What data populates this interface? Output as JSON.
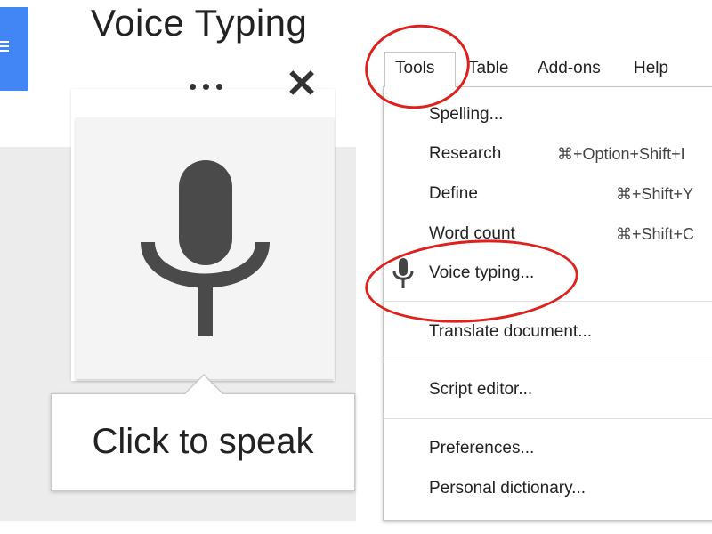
{
  "title": "Voice Typing",
  "voice_panel": {
    "more_icon": "more-horizontal-icon",
    "close_icon": "close-icon",
    "mic_icon": "microphone-icon",
    "speak_label": "Click to speak"
  },
  "menubar": {
    "items": [
      "Tools",
      "Table",
      "Add-ons",
      "Help"
    ]
  },
  "tools_menu": {
    "items": [
      {
        "label": "Spelling...",
        "shortcut": ""
      },
      {
        "label": "Research",
        "shortcut": "⌘+Option+Shift+I"
      },
      {
        "label": "Define",
        "shortcut": "⌘+Shift+Y"
      },
      {
        "label": "Word count",
        "shortcut": "⌘+Shift+C"
      },
      {
        "label": "Voice typing...",
        "shortcut": "",
        "icon": "microphone-icon"
      },
      {
        "label": "Translate document...",
        "shortcut": ""
      },
      {
        "label": "Script editor...",
        "shortcut": ""
      },
      {
        "label": "Preferences...",
        "shortcut": ""
      },
      {
        "label": "Personal dictionary...",
        "shortcut": ""
      }
    ]
  },
  "colors": {
    "docs_blue": "#4285f4",
    "highlight_red": "#e0201c",
    "mic_gray": "#4a4a4a"
  }
}
